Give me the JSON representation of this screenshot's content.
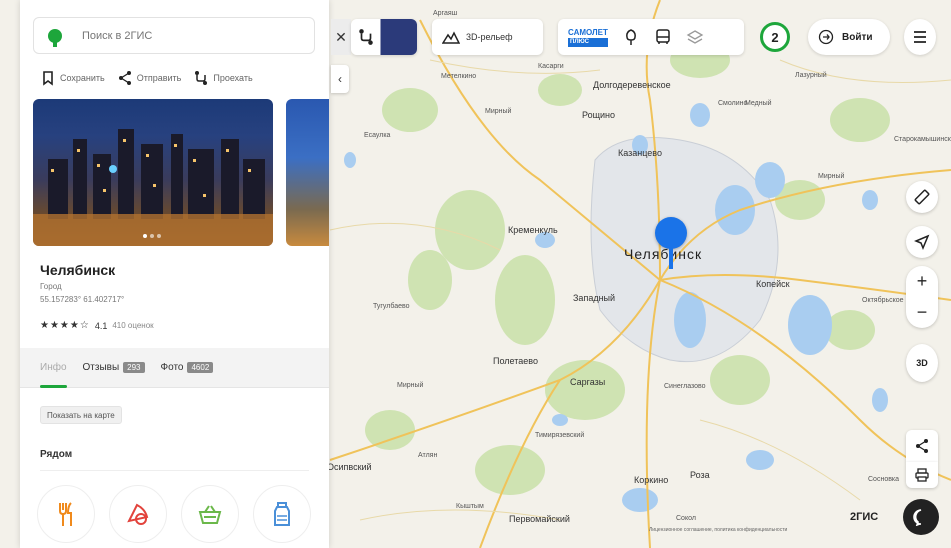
{
  "panel": {
    "search_placeholder": "Поиск в 2ГИС",
    "actions": [
      "Сохранить",
      "Отправить",
      "Проехать"
    ],
    "place": {
      "name": "Челябинск",
      "type": "Город",
      "coords": "55.157283° 61.402717°",
      "stars": "★★★★☆",
      "rating": "4.1",
      "reviews": "410 оценок"
    },
    "tabs": [
      {
        "label": "Инфо"
      },
      {
        "label": "Отзывы",
        "badge": "293"
      },
      {
        "label": "Фото",
        "badge": "4602"
      }
    ],
    "show_on_map": "Показать на карте",
    "nearby_title": "Рядом",
    "categories": [
      {
        "icon": "fork-knife-icon",
        "color": "#f08a1c"
      },
      {
        "icon": "pizza-icon",
        "color": "#e2433c"
      },
      {
        "icon": "shopping-basket-icon",
        "color": "#6bb84a"
      },
      {
        "icon": "bottle-icon",
        "color": "#4a8fd8"
      }
    ]
  },
  "toolbar": {
    "relief_label": "3D-рельеф",
    "samolet_label": "САМОЛЕТ",
    "samolet_sub": "ПЛЮС",
    "notification_count": "2",
    "login_label": "Войти"
  },
  "controls": {
    "view_3d": "3D"
  },
  "map": {
    "city_label": "Челябинск",
    "towns": [
      {
        "name": "Копейск"
      },
      {
        "name": "Кременкуль"
      },
      {
        "name": "Полетаево"
      },
      {
        "name": "Рощино"
      },
      {
        "name": "Казанцево"
      },
      {
        "name": "Долгодеревенское"
      },
      {
        "name": "Коркино"
      },
      {
        "name": "Роза"
      },
      {
        "name": "Первомайский"
      },
      {
        "name": "Саргазы"
      },
      {
        "name": "Западный"
      },
      {
        "name": "Осипвский"
      }
    ],
    "small_labels": [
      {
        "name": "Аргаяш"
      },
      {
        "name": "Касарги"
      },
      {
        "name": "Метелкино"
      },
      {
        "name": "Мирный"
      },
      {
        "name": "Лазурный"
      },
      {
        "name": "Есаулка"
      },
      {
        "name": "Тугулбаево"
      },
      {
        "name": "Мирный"
      },
      {
        "name": "Смолино"
      },
      {
        "name": "Тимирязевский"
      },
      {
        "name": "Атлян"
      },
      {
        "name": "Мирный"
      },
      {
        "name": "Сосновка"
      },
      {
        "name": "Октябрьское"
      },
      {
        "name": "Сокол"
      },
      {
        "name": "Медный"
      },
      {
        "name": "Старокамышинск"
      },
      {
        "name": "Кыштым"
      },
      {
        "name": "Синеглазово"
      }
    ],
    "brand": "2ГИС",
    "legal": "Лицензионное соглашение, политика конфиденциальности"
  }
}
